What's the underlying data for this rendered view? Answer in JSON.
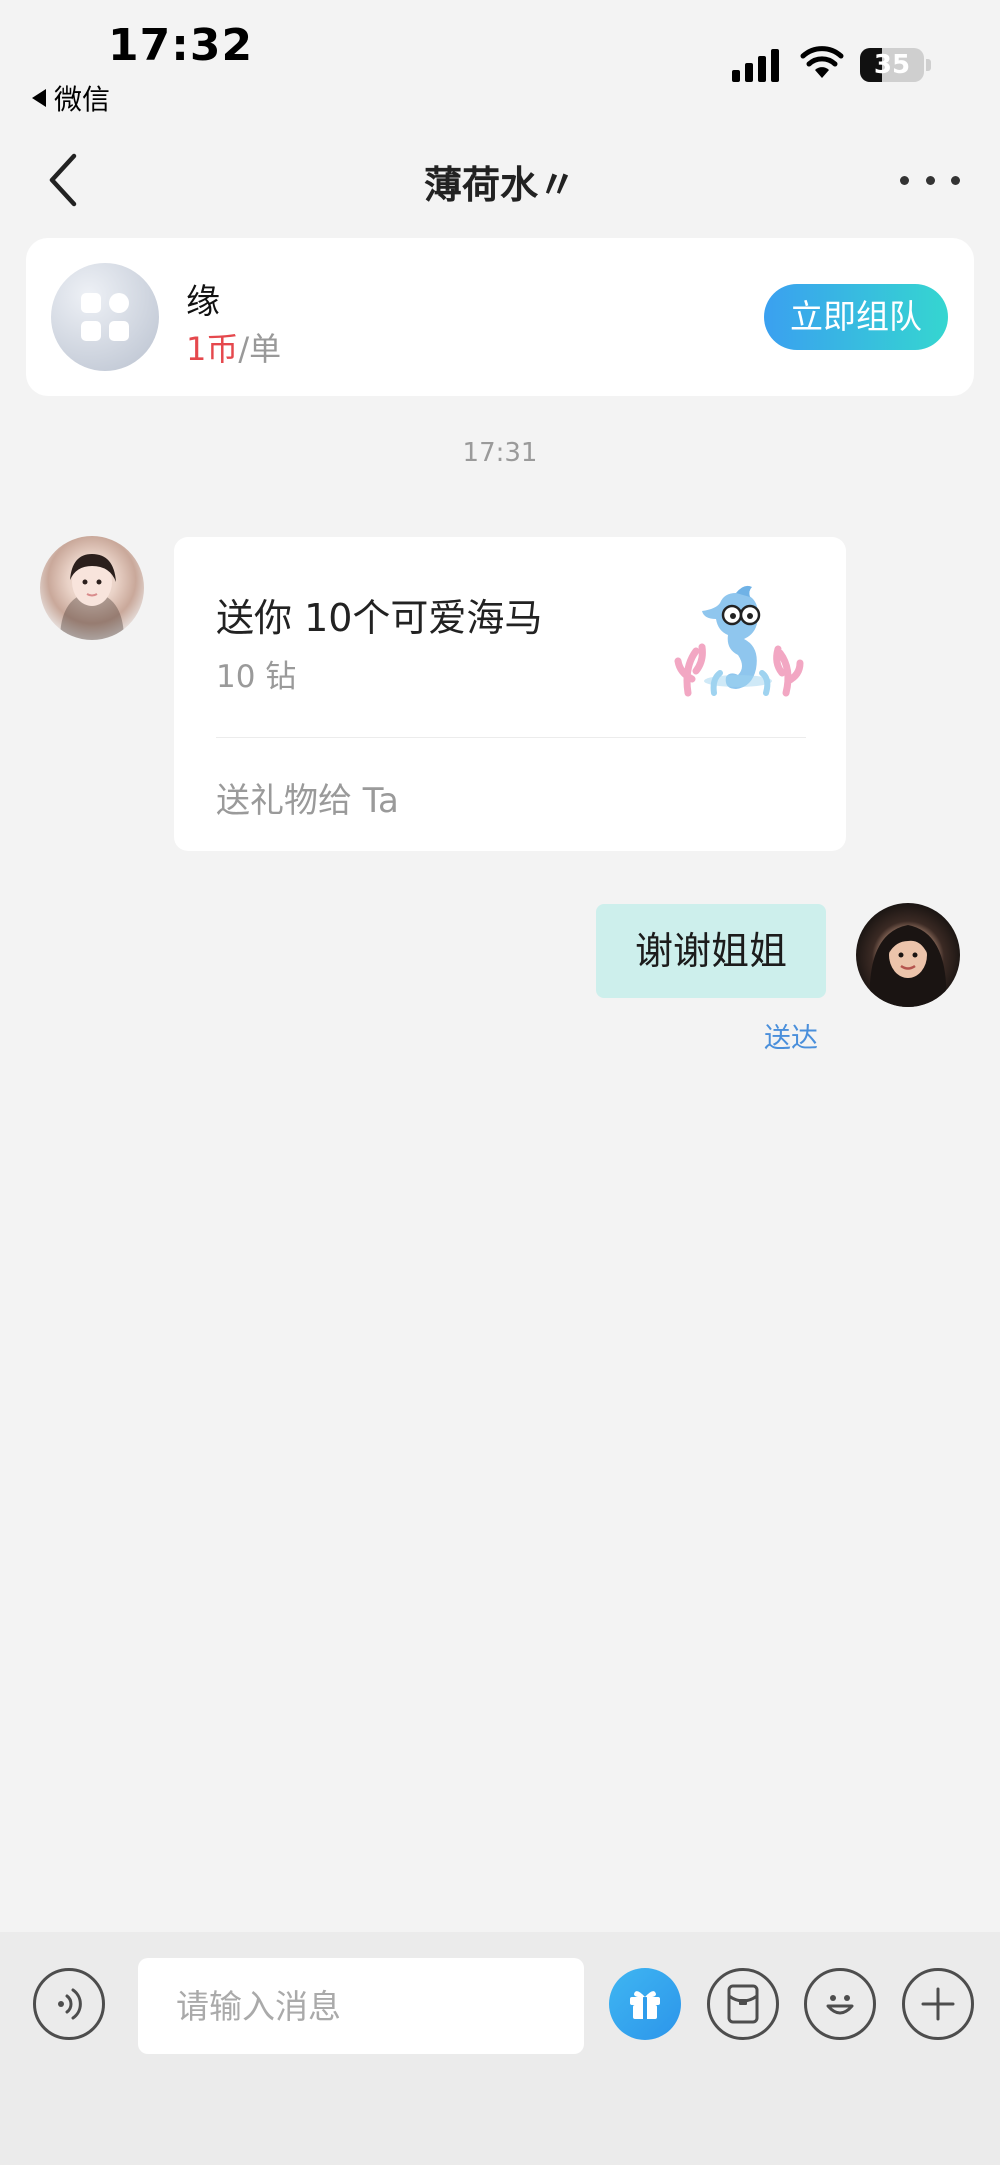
{
  "status_bar": {
    "time": "17:32",
    "back_app": "微信",
    "battery": "35",
    "battery_level": 0.35
  },
  "nav": {
    "title": "薄荷水〃"
  },
  "service": {
    "name": "缘",
    "price_amount": "1币",
    "price_unit": "/单",
    "button": "立即组队"
  },
  "chat": {
    "timestamp": "17:31",
    "gift": {
      "title": "送你 10个可爱海马",
      "price": "10 钻",
      "action": "送礼物给 Ta"
    },
    "outgoing_message": "谢谢姐姐",
    "delivery_status": "送达"
  },
  "input": {
    "placeholder": "请输入消息"
  },
  "colors": {
    "accent_blue": "#3aa0f0",
    "accent_teal": "#35d6d0",
    "price_red": "#e5484d",
    "bubble_out": "#cdefec",
    "status_blue": "#4a8fdb"
  }
}
